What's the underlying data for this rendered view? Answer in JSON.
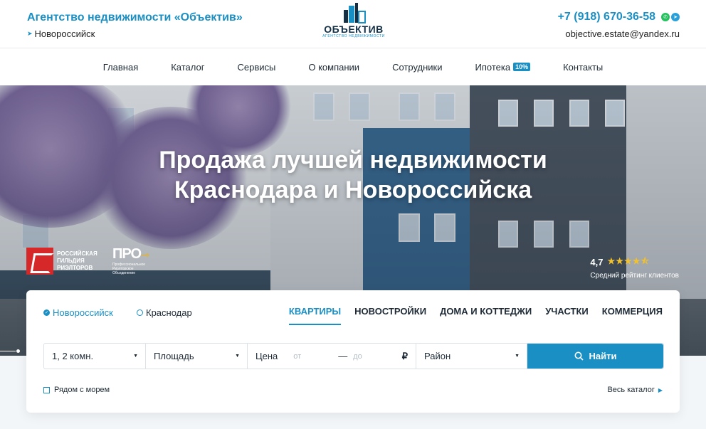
{
  "header": {
    "agency_title": "Агентство недвижимости «Объектив»",
    "city": "Новороссийск",
    "logo_word": "ОБЪЕКТИВ",
    "logo_sub": "АГЕНТСТВО НЕДВИЖИМОСТИ",
    "phone": "+7 (918) 670-36-58",
    "email": "objective.estate@yandex.ru"
  },
  "nav": {
    "items": [
      {
        "label": "Главная"
      },
      {
        "label": "Каталог"
      },
      {
        "label": "Сервисы"
      },
      {
        "label": "О компании"
      },
      {
        "label": "Сотрудники"
      },
      {
        "label": "Ипотека",
        "badge": "10%"
      },
      {
        "label": "Контакты"
      }
    ]
  },
  "hero": {
    "title_line1": "Продажа лучшей недвижимости",
    "title_line2": "Краснодара и Новороссийска",
    "rgr_text": "РОССИЙСКАЯ ГИЛЬДИЯ РИЭЛТОРОВ",
    "pro_mark": "ПРО",
    "pro_text": "Профессиональное Риэлторское Объединение",
    "rating_value": "4,7",
    "rating_stars": 4.5,
    "rating_caption": "Средний рейтинг клиентов"
  },
  "search": {
    "cities": [
      {
        "label": "Новороссийск",
        "selected": true
      },
      {
        "label": "Краснодар",
        "selected": false
      }
    ],
    "tabs": [
      {
        "label": "КВАРТИРЫ",
        "active": true
      },
      {
        "label": "НОВОСТРОЙКИ",
        "active": false
      },
      {
        "label": "ДОМА И КОТТЕДЖИ",
        "active": false
      },
      {
        "label": "УЧАСТКИ",
        "active": false
      },
      {
        "label": "КОММЕРЦИЯ",
        "active": false
      }
    ],
    "rooms_value": "1, 2 комн.",
    "area_label": "Площадь",
    "price_label": "Цена",
    "price_from_placeholder": "от",
    "price_dash": "—",
    "price_to_placeholder": "до",
    "currency": "₽",
    "district_label": "Район",
    "find_label": "Найти",
    "sea_label": "Рядом с морем",
    "catalog_link": "Весь каталог"
  },
  "colors": {
    "accent": "#1a8fc4",
    "dark": "#1d2a36",
    "star": "#f2c12e",
    "rgr_red": "#d62828"
  }
}
